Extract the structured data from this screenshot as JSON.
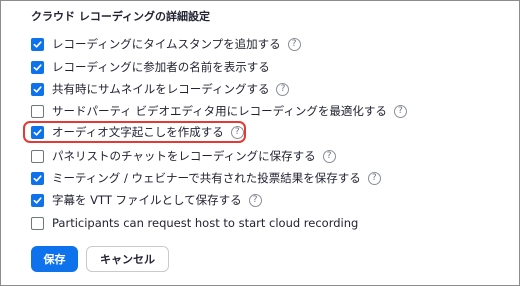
{
  "section": {
    "title": "クラウド レコーディングの詳細設定"
  },
  "options": [
    {
      "label": "レコーディングにタイムスタンプを追加する",
      "checked": true,
      "help": true
    },
    {
      "label": "レコーディングに参加者の名前を表示する",
      "checked": true,
      "help": false
    },
    {
      "label": "共有時にサムネイルをレコーディングする",
      "checked": true,
      "help": true
    },
    {
      "label": "サードパーティ ビデオエディタ用にレコーディングを最適化する",
      "checked": false,
      "help": true
    },
    {
      "label": "オーディオ文字起こしを作成する",
      "checked": true,
      "help": true,
      "highlighted": true
    },
    {
      "label": "パネリストのチャットをレコーディングに保存する",
      "checked": false,
      "help": true
    },
    {
      "label": "ミーティング / ウェビナーで共有された投票結果を保存する",
      "checked": true,
      "help": true
    },
    {
      "label": "字幕を VTT ファイルとして保存する",
      "checked": true,
      "help": true
    },
    {
      "label": "Participants can request host to start cloud recording",
      "checked": false,
      "help": false
    }
  ],
  "help_glyph": "?",
  "icons": {
    "help": "question-circle-icon",
    "check": "checkmark-icon"
  },
  "buttons": {
    "save_label": "保存",
    "cancel_label": "キャンセル"
  },
  "colors": {
    "accent": "#0e72ed",
    "highlight": "#e53935",
    "text": "#232333"
  }
}
